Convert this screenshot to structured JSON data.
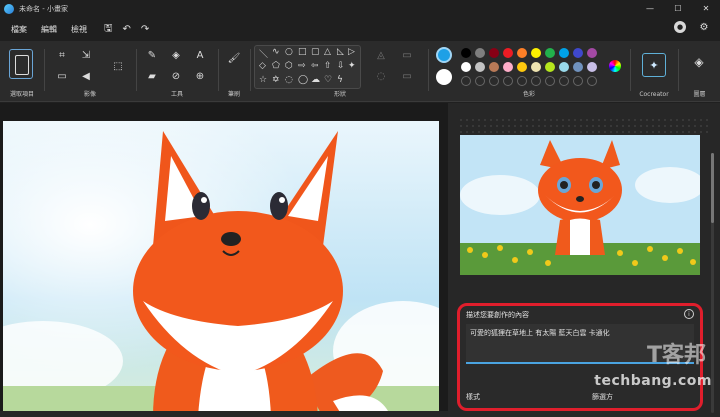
{
  "window": {
    "title": "未命名 - 小畫家"
  },
  "menu": {
    "items": [
      "檔案",
      "編輯",
      "檢視"
    ]
  },
  "ribbon": {
    "groups": [
      {
        "label": "選取項目"
      },
      {
        "label": "影像"
      },
      {
        "label": "工具"
      },
      {
        "label": "筆刷"
      },
      {
        "label": "形狀"
      },
      {
        "label": "色彩"
      },
      {
        "label": "Cocreator"
      },
      {
        "label": "圖層"
      }
    ],
    "colors": [
      "#000000",
      "#7f7f7f",
      "#880015",
      "#ed1c24",
      "#ff7f27",
      "#fff200",
      "#22b14c",
      "#00a2e8",
      "#3f48cc",
      "#a349a4",
      "#ffffff",
      "#c3c3c3",
      "#b97a57",
      "#ffaec9",
      "#ffc90e",
      "#efe4b0",
      "#b5e61d",
      "#99d9ea",
      "#7092be",
      "#c8bfe7"
    ],
    "primary_color": "#1ea0e6",
    "secondary_color": "#ffffff"
  },
  "cocreator": {
    "prompt_title": "描述您要創作的內容",
    "prompt_value": "可愛的狐狸在草地上 有太陽 藍天白雲 卡通化",
    "style_label": "樣式",
    "filter_label": "篩選方"
  },
  "watermark": {
    "cjk": "T客邦",
    "latin": "techbang.com"
  }
}
